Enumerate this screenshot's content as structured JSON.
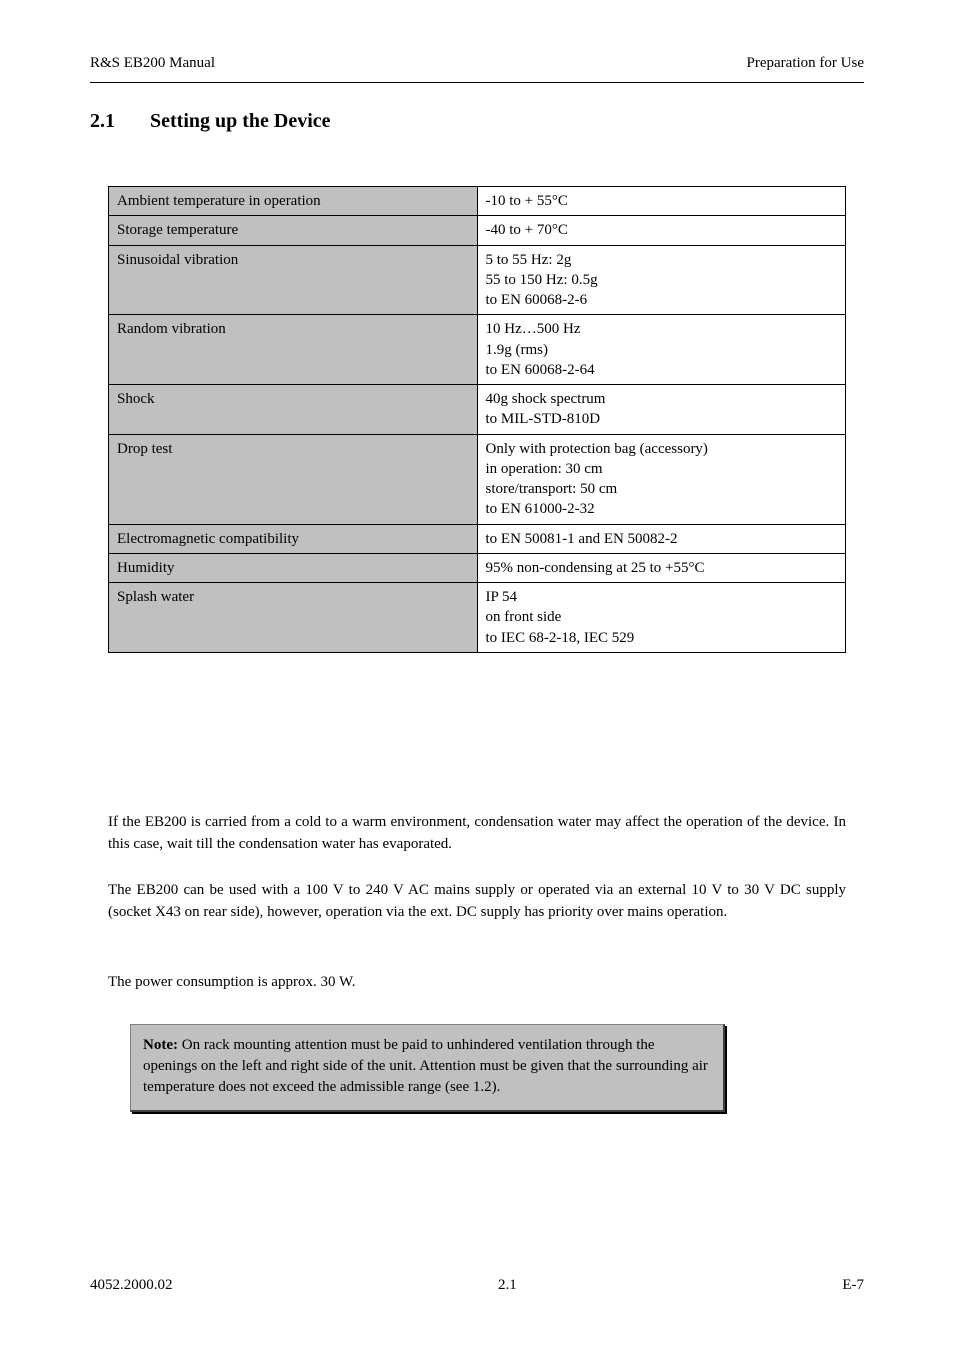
{
  "header": {
    "left": "R&S EB200 Manual",
    "right": "Preparation for Use"
  },
  "section": {
    "number": "2.1",
    "title": "Setting up the Device"
  },
  "table": {
    "rows": [
      {
        "label": "Ambient temperature in operation",
        "value": "-10 to + 55°C"
      },
      {
        "label": "Storage temperature",
        "value": "-40 to + 70°C"
      },
      {
        "label": "Sinusoidal vibration",
        "value": "5 to 55 Hz: 2g<br>55 to 150 Hz: 0.5g<br>to EN 60068-2-6"
      },
      {
        "label": "Random vibration",
        "value": "10 Hz…500 Hz<br>1.9g (rms)<br>to EN 60068-2-64"
      },
      {
        "label": "Shock",
        "value": "40g shock spectrum<br>to MIL-STD-810D"
      },
      {
        "label": "Drop test",
        "value": "Only with protection bag (accessory)<br>in operation: 30 cm<br>store/transport: 50 cm<br>to EN 61000-2-32"
      },
      {
        "label": "Electromagnetic compatibility",
        "value": "to EN 50081-1 and EN 50082-2"
      },
      {
        "label": "Humidity",
        "value": "95% non-condensing at 25 to +55°C"
      },
      {
        "label": "Splash water",
        "value": "IP 54<br>on front side <br>to IEC 68-2-18, IEC 529"
      }
    ]
  },
  "paragraphs": {
    "p1": "If the EB200 is carried from a cold to a warm environment, condensation water may affect the operation of the device. In this case, wait till the condensation water has evaporated.",
    "p2": "The EB200 can be used with a 100 V to 240 V AC mains supply or operated via an external 10 V to 30 V DC supply (socket X43 on rear side), however, operation via the ext. DC supply has priority over mains operation.",
    "p3": "The power consumption is approx. 30 W."
  },
  "note": {
    "label": "Note:",
    "body": " On rack mounting attention must be paid to unhindered ventilation through the openings on the left and right side of the unit. Attention must be given that the surrounding air temperature does not exceed the admissible range (see 1.2)."
  },
  "footer": {
    "left": "4052.2000.02",
    "center": "2.1",
    "right": "E-7"
  }
}
